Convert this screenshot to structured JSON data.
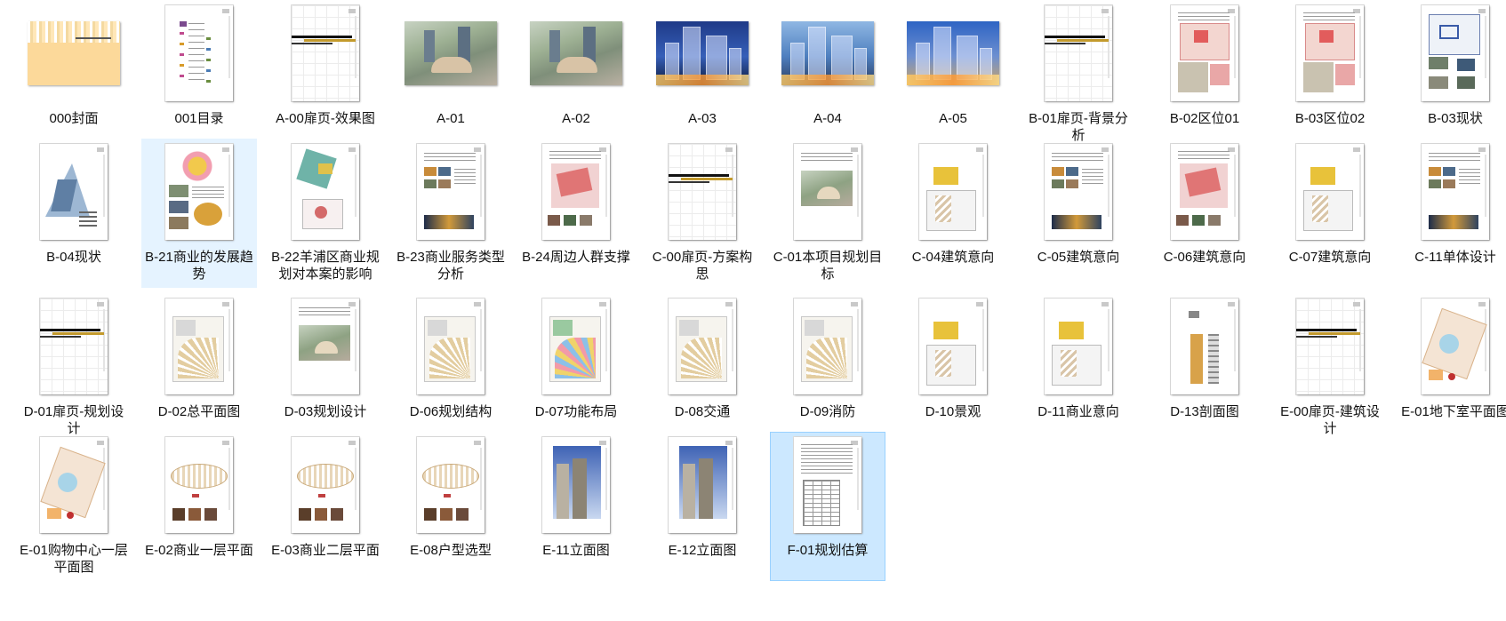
{
  "files": [
    {
      "name": "000封面",
      "thumb": "cover"
    },
    {
      "name": "001目录",
      "thumb": "toc"
    },
    {
      "name": "A-00扉页-效果图",
      "thumb": "title"
    },
    {
      "name": "A-01",
      "thumb": "aerial"
    },
    {
      "name": "A-02",
      "thumb": "aerial"
    },
    {
      "name": "A-03",
      "thumb": "night1"
    },
    {
      "name": "A-04",
      "thumb": "night2"
    },
    {
      "name": "A-05",
      "thumb": "night3"
    },
    {
      "name": "B-01扉页-背景分析",
      "thumb": "title"
    },
    {
      "name": "B-02区位01",
      "thumb": "map"
    },
    {
      "name": "B-03区位02",
      "thumb": "map"
    },
    {
      "name": "B-03现状",
      "thumb": "mappics"
    },
    {
      "name": "B-04现状",
      "thumb": "diagram"
    },
    {
      "name": "B-21商业的发展趋势",
      "thumb": "tri",
      "state": "hover"
    },
    {
      "name": "B-22羊浦区商业规划对本案的影响",
      "thumb": "mapdiagram"
    },
    {
      "name": "B-23商业服务类型分析",
      "thumb": "pics"
    },
    {
      "name": "B-24周边人群支撑",
      "thumb": "redmap"
    },
    {
      "name": "C-00扉页-方案构思",
      "thumb": "title"
    },
    {
      "name": "C-01本项目规划目标",
      "thumb": "aerialpage"
    },
    {
      "name": "C-04建筑意向",
      "thumb": "plan"
    },
    {
      "name": "C-05建筑意向",
      "thumb": "pics"
    },
    {
      "name": "C-06建筑意向",
      "thumb": "redmap"
    },
    {
      "name": "C-07建筑意向",
      "thumb": "plan"
    },
    {
      "name": "C-11单体设计",
      "thumb": "pics"
    },
    {
      "name": "D-01扉页-规划设计",
      "thumb": "title"
    },
    {
      "name": "D-02总平面图",
      "thumb": "fan"
    },
    {
      "name": "D-03规划设计",
      "thumb": "aerialpage"
    },
    {
      "name": "D-06规划结构",
      "thumb": "fan"
    },
    {
      "name": "D-07功能布局",
      "thumb": "fancolor"
    },
    {
      "name": "D-08交通",
      "thumb": "fan"
    },
    {
      "name": "D-09消防",
      "thumb": "fan"
    },
    {
      "name": "D-10景观",
      "thumb": "plan"
    },
    {
      "name": "D-11商业意向",
      "thumb": "plan"
    },
    {
      "name": "D-13剖面图",
      "thumb": "section"
    },
    {
      "name": "E-00扉页-建筑设计",
      "thumb": "title"
    },
    {
      "name": "E-01地下室平面图",
      "thumb": "floorplan"
    },
    {
      "name": "E-01购物中心一层平面图",
      "thumb": "floorplan"
    },
    {
      "name": "E-02商业一层平面",
      "thumb": "oval"
    },
    {
      "name": "E-03商业二层平面",
      "thumb": "oval"
    },
    {
      "name": "E-08户型选型",
      "thumb": "oval"
    },
    {
      "name": "E-11立面图",
      "thumb": "elevation"
    },
    {
      "name": "E-12立面图",
      "thumb": "elevation"
    },
    {
      "name": "F-01规划估算",
      "thumb": "table",
      "state": "selected"
    }
  ],
  "colors": {
    "hover_bg": "#e5f3ff",
    "selected_bg": "#cce8ff",
    "selected_border": "#99d1ff",
    "label_text": "#111111"
  }
}
